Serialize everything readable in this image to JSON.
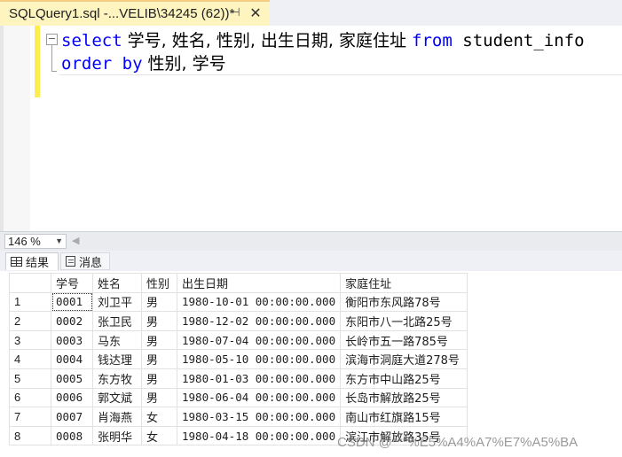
{
  "tab": {
    "title": "SQLQuery1.sql -...VELIB\\34245 (62))*",
    "pin_glyph": "⊣",
    "close_glyph": "✕"
  },
  "editor": {
    "fold_glyph": "−",
    "line1": {
      "kw_select": "select",
      "columns": " 学号, 姓名, 性别, 出生日期, 家庭住址 ",
      "kw_from": "from",
      "table": " student_info"
    },
    "line2": {
      "kw_order_by": "order by",
      "columns": " 性别, 学号"
    }
  },
  "zoom": {
    "value": "146 %",
    "arrow": "▼",
    "scroll_left": "◀"
  },
  "result_tabs": {
    "results_label": "结果",
    "messages_label": "消息"
  },
  "grid": {
    "headers": [
      "学号",
      "姓名",
      "性别",
      "出生日期",
      "家庭住址"
    ],
    "rows": [
      [
        "1",
        "0001",
        "刘卫平",
        "男",
        "1980-10-01 00:00:00.000",
        "衡阳市东风路78号"
      ],
      [
        "2",
        "0002",
        "张卫民",
        "男",
        "1980-12-02 00:00:00.000",
        "东阳市八一北路25号"
      ],
      [
        "3",
        "0003",
        "马东",
        "男",
        "1980-07-04 00:00:00.000",
        "长岭市五一路785号"
      ],
      [
        "4",
        "0004",
        "钱达理",
        "男",
        "1980-05-10 00:00:00.000",
        "滨海市洞庭大道278号"
      ],
      [
        "5",
        "0005",
        "东方牧",
        "男",
        "1980-01-03 00:00:00.000",
        "东方市中山路25号"
      ],
      [
        "6",
        "0006",
        "郭文斌",
        "男",
        "1980-06-04 00:00:00.000",
        "长岛市解放路25号"
      ],
      [
        "7",
        "0007",
        "肖海燕",
        "女",
        "1980-03-15 00:00:00.000",
        "南山市红旗路15号"
      ],
      [
        "8",
        "0008",
        "张明华",
        "女",
        "1980-04-18 00:00:00.000",
        "滨江市解放路35号"
      ]
    ]
  },
  "watermark": "CSDN @***%E5%A4%A7%E7%A5%BA"
}
